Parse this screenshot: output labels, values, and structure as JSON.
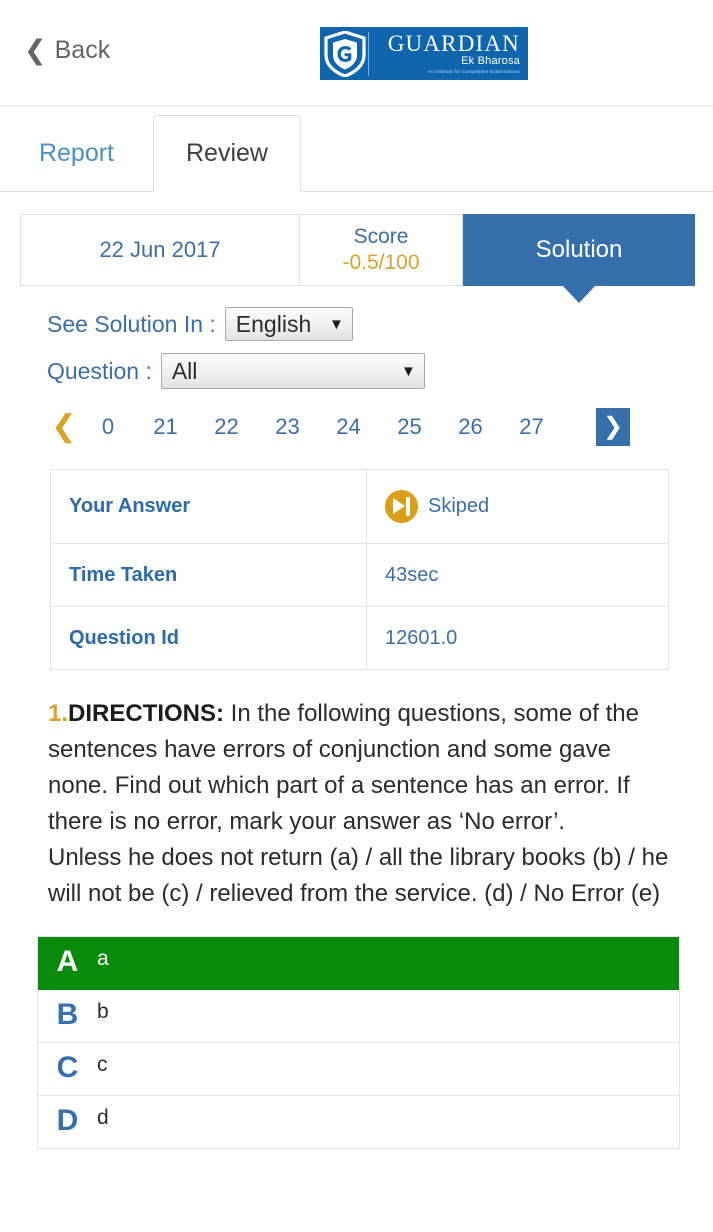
{
  "header": {
    "back_label": "Back",
    "back_icon": "chevron-left-icon",
    "logo": {
      "name": "GUARDIAN",
      "subtitle": "Ek Bharosa",
      "tagline": "An Institute for Competitive Examinations",
      "brand_color": "#1066ad"
    }
  },
  "tabs": [
    {
      "label": "Report",
      "active": false
    },
    {
      "label": "Review",
      "active": true
    }
  ],
  "info_strip": {
    "date": "22 Jun 2017",
    "score_label": "Score",
    "score_value": "-0.5/100",
    "solution_label": "Solution",
    "accent_blue": "#3570ab",
    "accent_gold": "#d9a22b"
  },
  "filters": {
    "language_label": "See Solution In :",
    "language_value": "English",
    "question_label": "Question :",
    "question_value": "All",
    "caret_icon": "chevron-down-icon"
  },
  "pagination": {
    "prev_icon": "chevron-left-icon",
    "next_icon": "chevron-right-icon",
    "pages": [
      "0",
      "21",
      "22",
      "23",
      "24",
      "25",
      "26",
      "27"
    ]
  },
  "meta": {
    "rows": [
      {
        "key": "Your Answer",
        "value": "Skiped",
        "icon": "skip-forward-icon"
      },
      {
        "key": "Time Taken",
        "value": "43sec",
        "icon": ""
      },
      {
        "key": "Question Id",
        "value": "12601.0",
        "icon": ""
      }
    ]
  },
  "question": {
    "number": "1.",
    "directions_label": "DIRECTIONS:",
    "directions_text": " In the following questions, some of the sentences have errors of conjunction and some gave none. Find out which part of a sentence has an error. If there is no error, mark your answer as ‘No error’.",
    "sentence": "Unless he does not return (a) / all the library books (b) / he will not be (c) / relieved from the service. (d) / No Error (e)"
  },
  "options": {
    "correct_color": "#088a0b",
    "items": [
      {
        "letter": "A",
        "text": "a",
        "correct": true
      },
      {
        "letter": "B",
        "text": "b",
        "correct": false
      },
      {
        "letter": "C",
        "text": "c",
        "correct": false
      },
      {
        "letter": "D",
        "text": "d",
        "correct": false
      }
    ]
  }
}
